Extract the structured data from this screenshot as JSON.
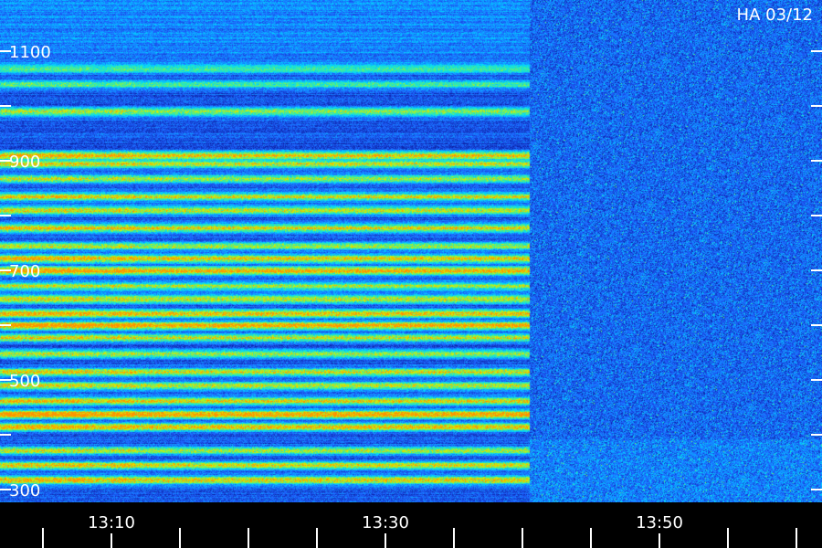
{
  "chart_data": {
    "type": "heatmap",
    "title": "HA 03/12",
    "xlabel": "",
    "ylabel": "",
    "y_ticks_labeled": [
      "1100",
      "900",
      "700",
      "500",
      "300"
    ],
    "y_tick_values": [
      1100,
      1000,
      900,
      800,
      700,
      600,
      500,
      400,
      300
    ],
    "ylim": [
      280,
      1180
    ],
    "x_ticks_labeled": [
      "13:10",
      "13:30",
      "13:50"
    ],
    "x_tick_values_min": [
      0,
      5,
      10,
      15,
      20,
      25,
      30,
      35,
      40,
      45,
      50,
      55,
      60
    ],
    "x_labeled_tick_values_min": [
      10,
      30,
      50
    ],
    "xlim_min": [
      2,
      62
    ],
    "signal_end_min": 40.5,
    "colorscale": [
      "#000018",
      "#0a1a9a",
      "#1e64ff",
      "#00d8ff",
      "#48f08c",
      "#d8f000",
      "#ff9000"
    ],
    "bands": [
      {
        "freq": 1068,
        "level": 0.3
      },
      {
        "freq": 1040,
        "level": 0.38
      },
      {
        "freq": 990,
        "level": 0.52
      },
      {
        "freq": 910,
        "level": 0.72
      },
      {
        "freq": 895,
        "level": 0.6
      },
      {
        "freq": 868,
        "level": 0.55
      },
      {
        "freq": 835,
        "level": 0.62
      },
      {
        "freq": 810,
        "level": 0.58
      },
      {
        "freq": 778,
        "level": 0.65
      },
      {
        "freq": 745,
        "level": 0.55
      },
      {
        "freq": 722,
        "level": 0.7
      },
      {
        "freq": 700,
        "level": 0.78
      },
      {
        "freq": 672,
        "level": 0.55
      },
      {
        "freq": 648,
        "level": 0.6
      },
      {
        "freq": 622,
        "level": 0.7
      },
      {
        "freq": 600,
        "level": 0.82
      },
      {
        "freq": 578,
        "level": 0.62
      },
      {
        "freq": 548,
        "level": 0.55
      },
      {
        "freq": 515,
        "level": 0.62
      },
      {
        "freq": 490,
        "level": 0.58
      },
      {
        "freq": 462,
        "level": 0.62
      },
      {
        "freq": 438,
        "level": 0.88
      },
      {
        "freq": 415,
        "level": 0.7
      },
      {
        "freq": 372,
        "level": 0.55
      },
      {
        "freq": 345,
        "level": 0.62
      },
      {
        "freq": 318,
        "level": 0.72
      }
    ]
  }
}
